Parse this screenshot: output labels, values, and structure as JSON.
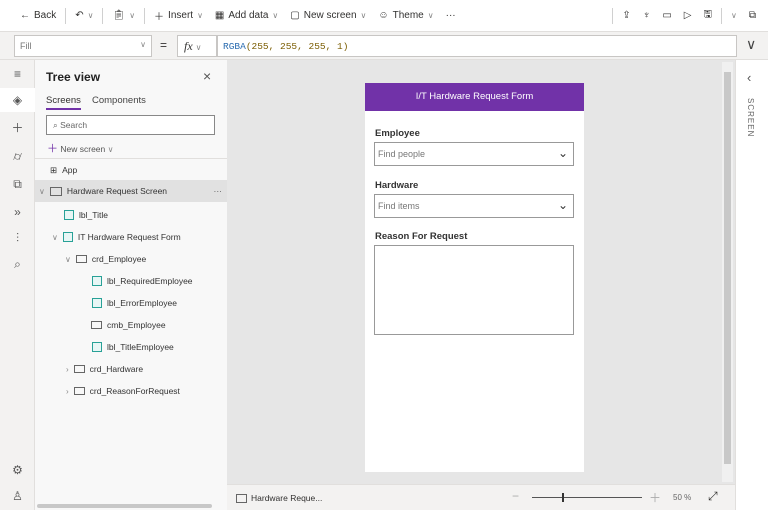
{
  "toolbar": {
    "back": "Back",
    "insert": "Insert",
    "add_data": "Add data",
    "new_screen": "New screen",
    "theme": "Theme",
    "more": "···"
  },
  "formula": {
    "property": "Fill",
    "equals": "=",
    "fx": "fx",
    "fn": "RGBA",
    "args": "(255, 255, 255, 1)"
  },
  "tree": {
    "title": "Tree view",
    "tabs": [
      "Screens",
      "Components"
    ],
    "search_placeholder": "Search",
    "new_screen": "New screen",
    "items": [
      {
        "label": "App"
      },
      {
        "label": "Hardware Request Screen"
      },
      {
        "label": "lbl_Title"
      },
      {
        "label": "IT Hardware Request Form"
      },
      {
        "label": "crd_Employee"
      },
      {
        "label": "lbl_RequiredEmployee"
      },
      {
        "label": "lbl_ErrorEmployee"
      },
      {
        "label": "cmb_Employee"
      },
      {
        "label": "lbl_TitleEmployee"
      },
      {
        "label": "crd_Hardware"
      },
      {
        "label": "crd_ReasonForRequest"
      }
    ],
    "more": "···"
  },
  "form": {
    "title": "I/T Hardware Request Form",
    "employee_label": "Employee",
    "employee_placeholder": "Find people",
    "hardware_label": "Hardware",
    "hardware_placeholder": "Find items",
    "reason_label": "Reason For Request"
  },
  "status": {
    "screen": "Hardware Reque...",
    "zoom": "50",
    "percent": "%",
    "zoom_fraction": 0.5
  },
  "right_panel": {
    "label": "SCREEN"
  },
  "colors": {
    "accent": "#7132a8"
  }
}
